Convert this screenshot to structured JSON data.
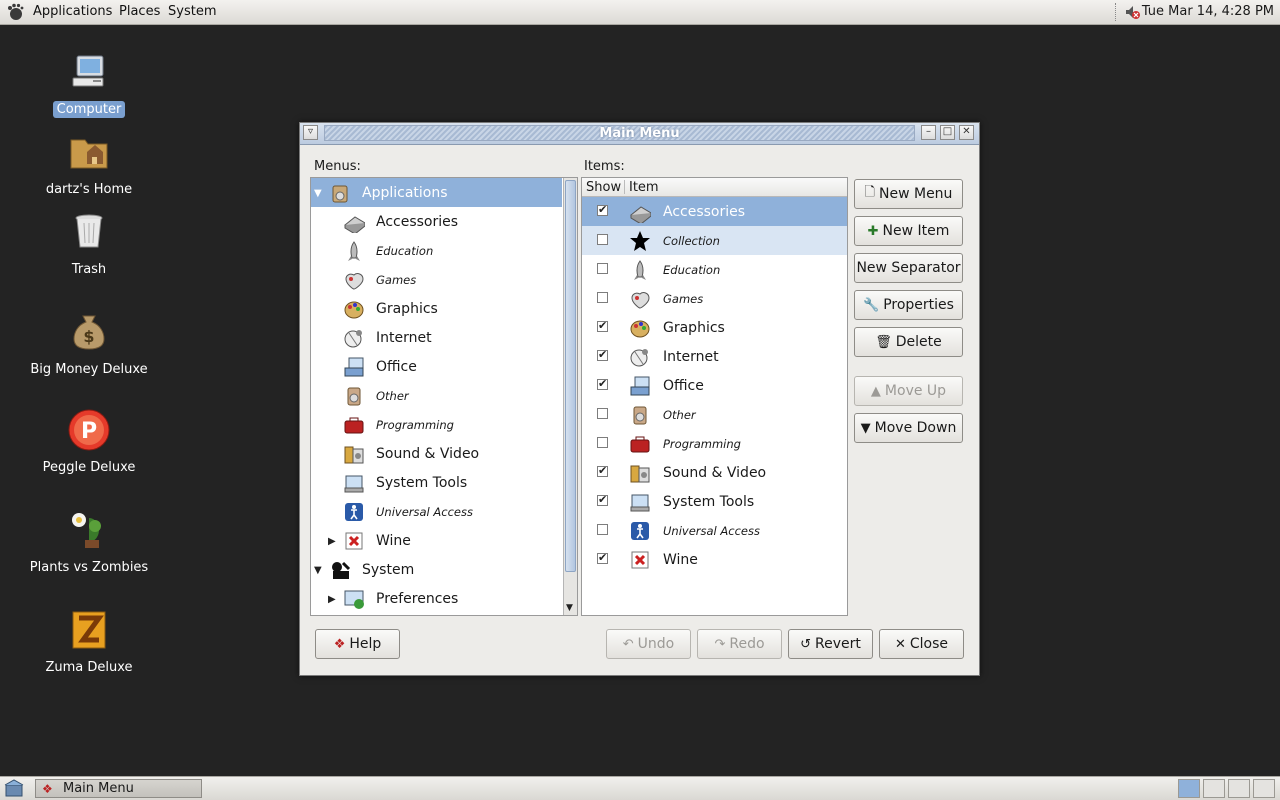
{
  "top_panel": {
    "menus": [
      "Applications",
      "Places",
      "System"
    ],
    "clock": "Tue Mar 14,  4:28 PM"
  },
  "desktop": {
    "icons": [
      {
        "label": "Computer",
        "icon": "computer-icon"
      },
      {
        "label": "dartz's Home",
        "icon": "home-folder-icon"
      },
      {
        "label": "Trash",
        "icon": "trash-icon"
      },
      {
        "label": "Big Money Deluxe",
        "icon": "money-bag-icon"
      },
      {
        "label": "Peggle Deluxe",
        "icon": "peggle-icon"
      },
      {
        "label": "Plants vs Zombies",
        "icon": "plants-icon"
      },
      {
        "label": "Zuma Deluxe",
        "icon": "zuma-icon"
      }
    ]
  },
  "window": {
    "title": "Main Menu",
    "menus_label": "Menus:",
    "items_label": "Items:",
    "tree": [
      {
        "label": "Applications",
        "level": 0,
        "expander": "open",
        "selected": true,
        "italic": false,
        "icon": "applications-icon"
      },
      {
        "label": "Accessories",
        "level": 1,
        "italic": false,
        "icon": "accessories-icon"
      },
      {
        "label": "Education",
        "level": 1,
        "italic": true,
        "icon": "education-icon"
      },
      {
        "label": "Games",
        "level": 1,
        "italic": true,
        "icon": "games-icon"
      },
      {
        "label": "Graphics",
        "level": 1,
        "italic": false,
        "icon": "graphics-icon"
      },
      {
        "label": "Internet",
        "level": 1,
        "italic": false,
        "icon": "internet-icon"
      },
      {
        "label": "Office",
        "level": 1,
        "italic": false,
        "icon": "office-icon"
      },
      {
        "label": "Other",
        "level": 1,
        "italic": true,
        "icon": "other-icon"
      },
      {
        "label": "Programming",
        "level": 1,
        "italic": true,
        "icon": "programming-icon"
      },
      {
        "label": "Sound & Video",
        "level": 1,
        "italic": false,
        "icon": "sound-video-icon"
      },
      {
        "label": "System Tools",
        "level": 1,
        "italic": false,
        "icon": "system-tools-icon"
      },
      {
        "label": "Universal Access",
        "level": 1,
        "italic": true,
        "icon": "universal-access-icon"
      },
      {
        "label": "Wine",
        "level": 1,
        "expander": "closed",
        "italic": false,
        "icon": "wine-icon"
      },
      {
        "label": "System",
        "level": 0,
        "expander": "open",
        "italic": false,
        "icon": "system-icon"
      },
      {
        "label": "Preferences",
        "level": 1,
        "expander": "closed",
        "italic": false,
        "icon": "preferences-icon"
      }
    ],
    "columns": {
      "show": "Show",
      "item": "Item"
    },
    "items": [
      {
        "label": "Accessories",
        "show": true,
        "italic": false,
        "state": "selected",
        "icon": "accessories-icon"
      },
      {
        "label": "Collection",
        "show": false,
        "italic": true,
        "state": "hover",
        "icon": "star-icon"
      },
      {
        "label": "Education",
        "show": false,
        "italic": true,
        "icon": "education-icon"
      },
      {
        "label": "Games",
        "show": false,
        "italic": true,
        "icon": "games-icon"
      },
      {
        "label": "Graphics",
        "show": true,
        "italic": false,
        "icon": "graphics-icon"
      },
      {
        "label": "Internet",
        "show": true,
        "italic": false,
        "icon": "internet-icon"
      },
      {
        "label": "Office",
        "show": true,
        "italic": false,
        "icon": "office-icon"
      },
      {
        "label": "Other",
        "show": false,
        "italic": true,
        "icon": "other-icon"
      },
      {
        "label": "Programming",
        "show": false,
        "italic": true,
        "icon": "programming-icon"
      },
      {
        "label": "Sound & Video",
        "show": true,
        "italic": false,
        "icon": "sound-video-icon"
      },
      {
        "label": "System Tools",
        "show": true,
        "italic": false,
        "icon": "system-tools-icon"
      },
      {
        "label": "Universal Access",
        "show": false,
        "italic": true,
        "icon": "universal-access-icon"
      },
      {
        "label": "Wine",
        "show": true,
        "italic": false,
        "icon": "wine-icon"
      }
    ],
    "buttons": {
      "new_menu": "New Menu",
      "new_item": "New Item",
      "new_separator": "New Separator",
      "properties": "Properties",
      "delete": "Delete",
      "move_up": "Move Up",
      "move_down": "Move Down",
      "help": "Help",
      "undo": "Undo",
      "redo": "Redo",
      "revert": "Revert",
      "close": "Close"
    }
  },
  "bottom_panel": {
    "task": "Main Menu"
  },
  "colors": {
    "selection": "#8fb1da",
    "desktop": "#232323",
    "panel": "#e8e6e2"
  }
}
